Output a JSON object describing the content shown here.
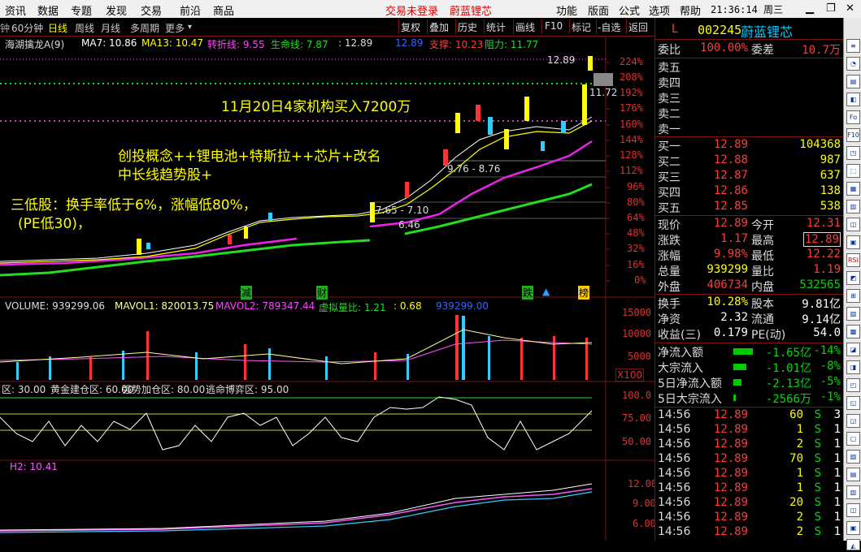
{
  "menu": {
    "items": [
      "资讯",
      "数据",
      "专题",
      "发现",
      "交易",
      "前沿",
      "商品"
    ],
    "trade_status": "交易未登录",
    "stock_name": "蔚蓝锂芯",
    "right_items": [
      "功能",
      "版面",
      "公式",
      "选项",
      "帮助"
    ],
    "clock": "21:36:14 周三"
  },
  "tabs": {
    "period": "60分钟",
    "items": [
      "日线",
      "周线",
      "月线",
      "多周期",
      "更多"
    ],
    "selected": "日线",
    "tools": [
      "复权",
      "叠加",
      "历史",
      "统计",
      "画线",
      "F10",
      "标记",
      "-自选",
      "返回"
    ]
  },
  "main": {
    "indicator_line": {
      "name": "海湖擒龙A(9)",
      "ma7": "MA7: 10.86",
      "ma13": "MA13: 10.47",
      "turn": "转折线: 9.55",
      "life": "生命线: 7.87",
      "cur": ": 12.89",
      "cur2": "12.89",
      "support": "支撑: 10.23",
      "resist": "阻力: 11.77"
    },
    "y_labels": [
      "224%",
      "208%",
      "192%",
      "176%",
      "160%",
      "144%",
      "128%",
      "112%",
      "96%",
      "80%",
      "64%",
      "48%",
      "32%",
      "16%",
      "0%"
    ],
    "price_marks": {
      "high": "12.89",
      "mid": "11.72",
      "range1": "9.76 - 8.76",
      "range2": "7.65 - 7.10",
      "low": "6.46"
    },
    "annotations": {
      "a1": "11月20日4家机构买入7200万",
      "a2": "创投概念++锂电池+特斯拉++芯片+改名",
      "a3": "中长线趋势股+",
      "a4": "三低股：换手率低于6%，涨幅低80%，",
      "a5": "(PE低30)，"
    },
    "events": {
      "e1": "减",
      "e2": "财",
      "e3": "跌",
      "e4": "榜"
    },
    "colors": {
      "ma7": "#ffffff",
      "ma13": "#ffff00",
      "turn": "#ff00ff",
      "life": "#00ff00",
      "up": "#ff3333",
      "down": "#33ccff",
      "yellow": "#ffff00"
    }
  },
  "volume": {
    "line": {
      "label": "VOLUME: 939299.06",
      "mavol1": "MAVOL1: 820013.75",
      "mavol2": "MAVOL2: 789347.44",
      "ratio": "虚拟量比: 1.21",
      "extra": ": 0.68",
      "cur": "939299.00"
    },
    "y_labels": [
      "15000",
      "10000",
      "5000"
    ],
    "unit": "X100"
  },
  "osc": {
    "line": {
      "a": "区: 30.00",
      "b": "黄金建仓区: 60.00",
      "c": "强势加仓区: 80.00",
      "d": "逃命博弈区: 95.00"
    },
    "y_labels": [
      "100.0",
      "75.00",
      "50.00"
    ]
  },
  "h2": {
    "line": "H2: 10.41",
    "y_labels": [
      "12.00",
      "9.00",
      "6.00"
    ]
  },
  "panel": {
    "code": "002245",
    "name": "蔚蓝锂芯",
    "flag": "L",
    "wei": {
      "label": "委比",
      "value": "100.00%",
      "label2": "委差",
      "value2": "10.7万"
    },
    "sells": [
      {
        "label": "卖五",
        "price": "",
        "vol": ""
      },
      {
        "label": "卖四",
        "price": "",
        "vol": ""
      },
      {
        "label": "卖三",
        "price": "",
        "vol": ""
      },
      {
        "label": "卖二",
        "price": "",
        "vol": ""
      },
      {
        "label": "卖一",
        "price": "",
        "vol": ""
      }
    ],
    "buys": [
      {
        "label": "买一",
        "price": "12.89",
        "vol": "104368"
      },
      {
        "label": "买二",
        "price": "12.88",
        "vol": "987"
      },
      {
        "label": "买三",
        "price": "12.87",
        "vol": "637"
      },
      {
        "label": "买四",
        "price": "12.86",
        "vol": "138"
      },
      {
        "label": "买五",
        "price": "12.85",
        "vol": "538"
      }
    ],
    "quote": [
      {
        "l1": "现价",
        "v1": "12.89",
        "c1": "red",
        "l2": "今开",
        "v2": "12.31",
        "c2": "red"
      },
      {
        "l1": "涨跌",
        "v1": "1.17",
        "c1": "red",
        "l2": "最高",
        "v2": "12.89",
        "c2": "red"
      },
      {
        "l1": "涨幅",
        "v1": "9.98%",
        "c1": "red",
        "l2": "最低",
        "v2": "12.22",
        "c2": "red"
      },
      {
        "l1": "总量",
        "v1": "939299",
        "c1": "yel",
        "l2": "量比",
        "v2": "1.19",
        "c2": "red"
      },
      {
        "l1": "外盘",
        "v1": "406734",
        "c1": "red",
        "l2": "内盘",
        "v2": "532565",
        "c2": "grn"
      }
    ],
    "fund": [
      {
        "l1": "换手",
        "v1": "10.28%",
        "l2": "股本",
        "v2": "9.81亿"
      },
      {
        "l1": "净资",
        "v1": "2.32",
        "l2": "流通",
        "v2": "9.14亿"
      },
      {
        "l1": "收益(三)",
        "v1": "0.179",
        "l2": "PE(动)",
        "v2": "54.0"
      }
    ],
    "flow": [
      {
        "label": "净流入额",
        "value": "-1.65亿",
        "pct": "-14%"
      },
      {
        "label": "大宗流入",
        "value": "-1.01亿",
        "pct": "-8%"
      },
      {
        "label": "5日净流入额",
        "value": "-2.13亿",
        "pct": "-5%"
      },
      {
        "label": "5日大宗流入",
        "value": "-2566万",
        "pct": "-1%"
      }
    ],
    "ticks": [
      {
        "t": "14:56",
        "p": "12.89",
        "v": "60",
        "s": "S",
        "n": "3"
      },
      {
        "t": "14:56",
        "p": "12.89",
        "v": "1",
        "s": "S",
        "n": "1"
      },
      {
        "t": "14:56",
        "p": "12.89",
        "v": "2",
        "s": "S",
        "n": "1"
      },
      {
        "t": "14:56",
        "p": "12.89",
        "v": "70",
        "s": "S",
        "n": "1"
      },
      {
        "t": "14:56",
        "p": "12.89",
        "v": "1",
        "s": "S",
        "n": "1"
      },
      {
        "t": "14:56",
        "p": "12.89",
        "v": "1",
        "s": "S",
        "n": "1"
      },
      {
        "t": "14:56",
        "p": "12.89",
        "v": "20",
        "s": "S",
        "n": "1"
      },
      {
        "t": "14:56",
        "p": "12.89",
        "v": "2",
        "s": "S",
        "n": "1"
      },
      {
        "t": "14:56",
        "p": "12.89",
        "v": "2",
        "s": "S",
        "n": "1"
      }
    ]
  },
  "side_icons": [
    "≡",
    "◔",
    "▤",
    "◧",
    "Fo",
    "F10",
    "◳",
    "⬚",
    "▦",
    "▥",
    "◫",
    "▣",
    "RSI",
    "◩",
    "⊞",
    "▨",
    "▩",
    "◪",
    "◨",
    "◰",
    "◱",
    "◲",
    "▢",
    "▧",
    "▤",
    "▥",
    "◫",
    "▣",
    "◭"
  ]
}
